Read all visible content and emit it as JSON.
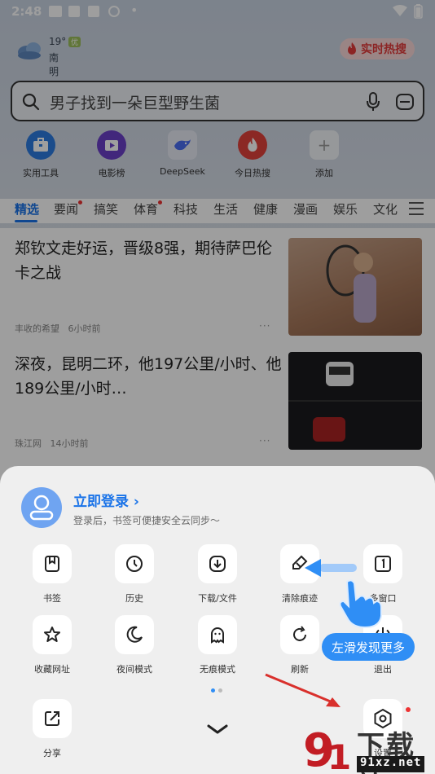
{
  "status_bar": {
    "time": "2:48"
  },
  "weather": {
    "temp": "19°",
    "quality": "优",
    "location": "南明区 阴"
  },
  "hot_search": {
    "label": "实时热搜"
  },
  "search": {
    "query": "男子找到一朵巨型野生菌"
  },
  "shortcuts": [
    {
      "label": "实用工具",
      "icon": "toolbox-icon",
      "color": "#2d7be0"
    },
    {
      "label": "电影榜",
      "icon": "film-icon",
      "color": "#6b3fc9"
    },
    {
      "label": "DeepSeek",
      "icon": "deepseek-icon",
      "color": "#4a6cf0"
    },
    {
      "label": "今日热搜",
      "icon": "fire-icon",
      "color": "#e0413a"
    },
    {
      "label": "添加",
      "icon": "plus-icon",
      "color": "#999999"
    }
  ],
  "tabs": [
    "精选",
    "要闻",
    "搞笑",
    "体育",
    "科技",
    "生活",
    "健康",
    "漫画",
    "娱乐",
    "文化"
  ],
  "articles": [
    {
      "title": "郑钦文走好运，晋级8强，期待萨巴伦卡之战",
      "source": "丰收的希望",
      "time": "6小时前",
      "more": "···"
    },
    {
      "title": "深夜，昆明二环，他197公里/小时、他189公里/小时…",
      "source": "珠江网",
      "time": "14小时前",
      "more": "···"
    }
  ],
  "sheet": {
    "login_title": "立即登录",
    "login_sub": "登录后，书签可便捷安全云同步～",
    "items": [
      {
        "label": "书签",
        "icon": "bookmark-icon"
      },
      {
        "label": "历史",
        "icon": "clock-icon"
      },
      {
        "label": "下载/文件",
        "icon": "download-icon"
      },
      {
        "label": "清除痕迹",
        "icon": "broom-icon"
      },
      {
        "label": "多窗口",
        "icon": "window-icon"
      },
      {
        "label": "收藏网址",
        "icon": "star-icon"
      },
      {
        "label": "夜间模式",
        "icon": "moon-icon"
      },
      {
        "label": "无痕模式",
        "icon": "ghost-icon"
      },
      {
        "label": "刷新",
        "icon": "refresh-icon"
      },
      {
        "label": "退出",
        "icon": "power-icon"
      },
      {
        "label": "分享",
        "icon": "share-icon"
      },
      {
        "label": "设置",
        "icon": "settings-icon"
      }
    ],
    "hint": "左滑发现更多",
    "active_page": 1,
    "page_count": 2
  },
  "colors": {
    "accent": "#1a73e8",
    "hint_bg": "#2f8ef5",
    "hot": "#e23b3b"
  },
  "watermark": {
    "cn": "下载站",
    "url": "91xz.net"
  }
}
